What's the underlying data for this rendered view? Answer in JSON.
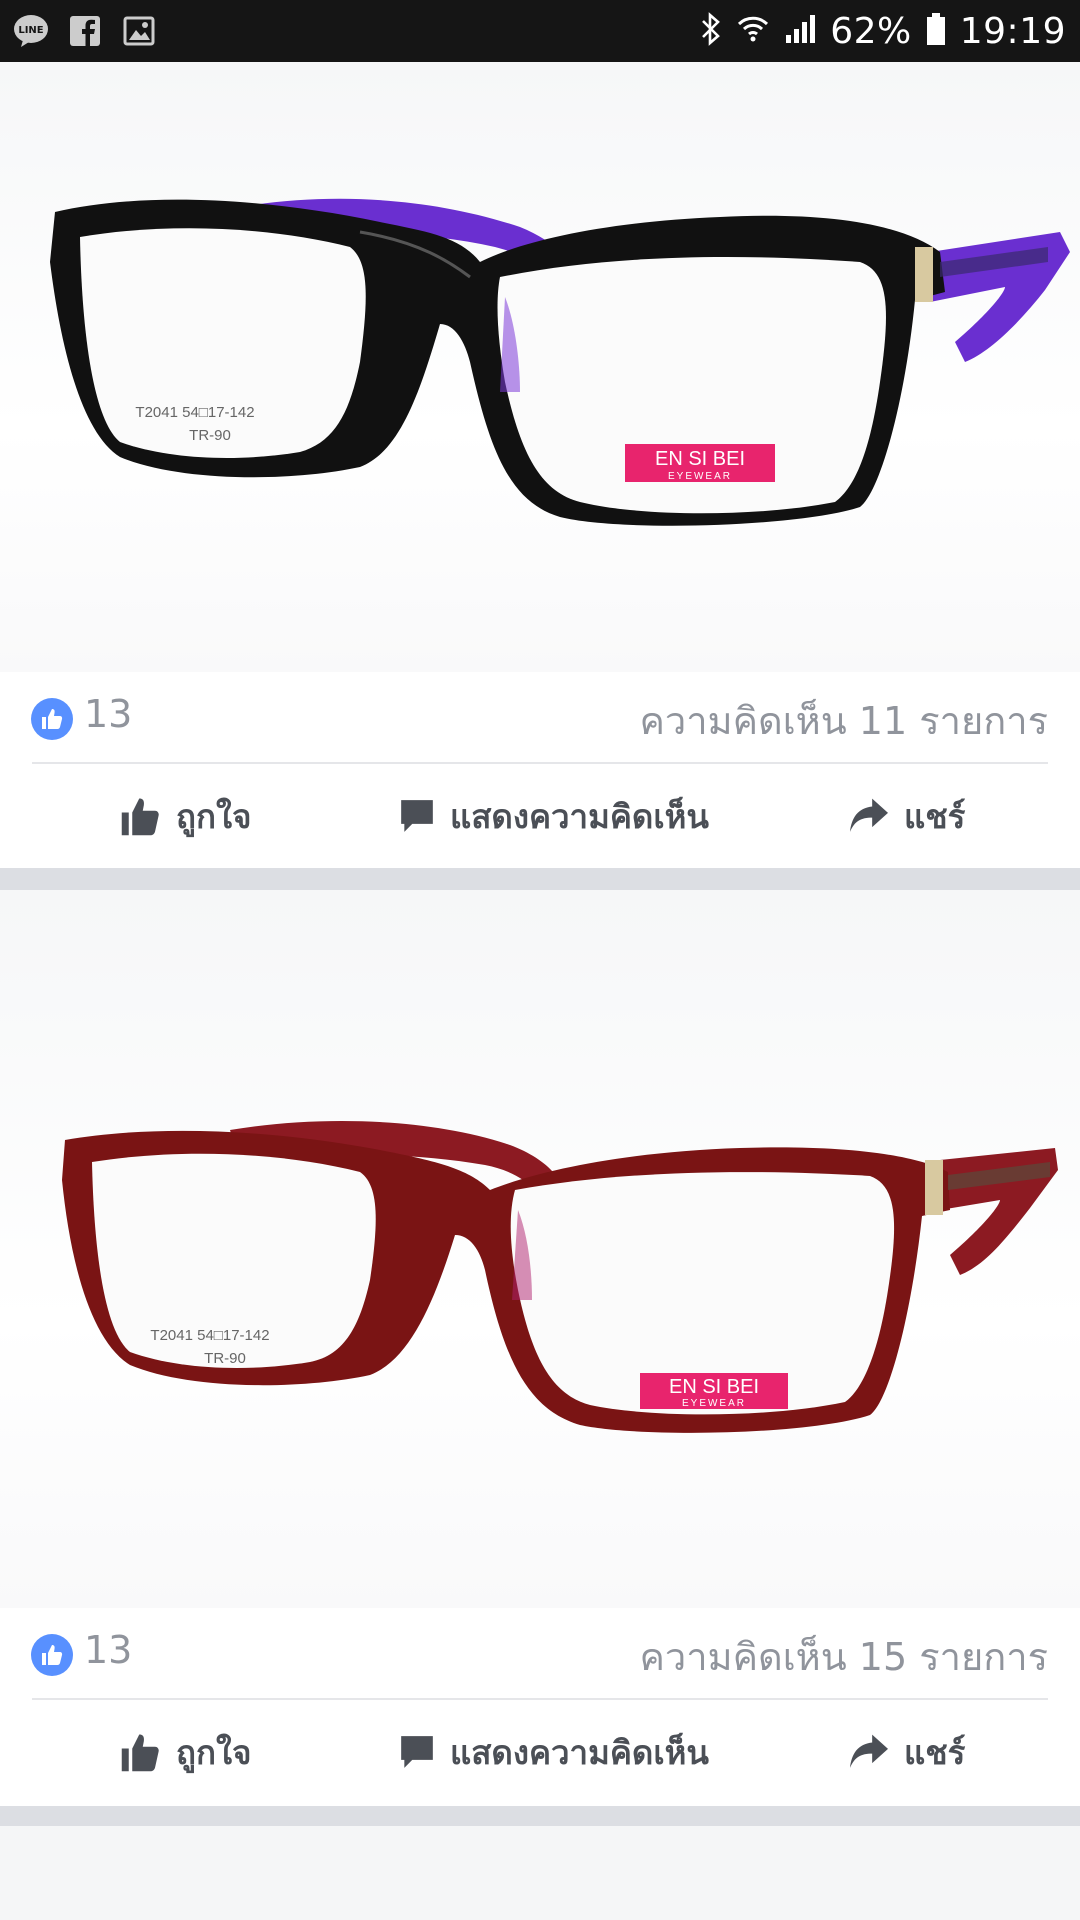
{
  "status_bar": {
    "left_icons": [
      "line-icon",
      "facebook-icon",
      "image-icon"
    ],
    "battery": "62%",
    "time": "19:19"
  },
  "posts": [
    {
      "photo": {
        "frame_color": "#111111",
        "temple_color": "#6a2fd0",
        "model_text": "T2041 54□17-142",
        "material_text": "TR-90",
        "brand": "EN SI BEI",
        "brand_sub": "EYEWEAR"
      },
      "likes": "13",
      "comments": "ความคิดเห็น 11 รายการ",
      "actions": {
        "like": "ถูกใจ",
        "comment": "แสดงความคิดเห็น",
        "share": "แชร์"
      }
    },
    {
      "photo": {
        "frame_color": "#7a1414",
        "temple_color": "#8c1a22",
        "model_text": "T2041 54□17-142",
        "material_text": "TR-90",
        "brand": "EN SI BEI",
        "brand_sub": "EYEWEAR"
      },
      "likes": "13",
      "comments": "ความคิดเห็น 15 รายการ",
      "actions": {
        "like": "ถูกใจ",
        "comment": "แสดงความคิดเห็น",
        "share": "แชร์"
      }
    }
  ],
  "colors": {
    "accent": "#5890ff",
    "meta_text": "#90949c",
    "action_text": "#4b4f56",
    "separator": "#dcdee3"
  }
}
